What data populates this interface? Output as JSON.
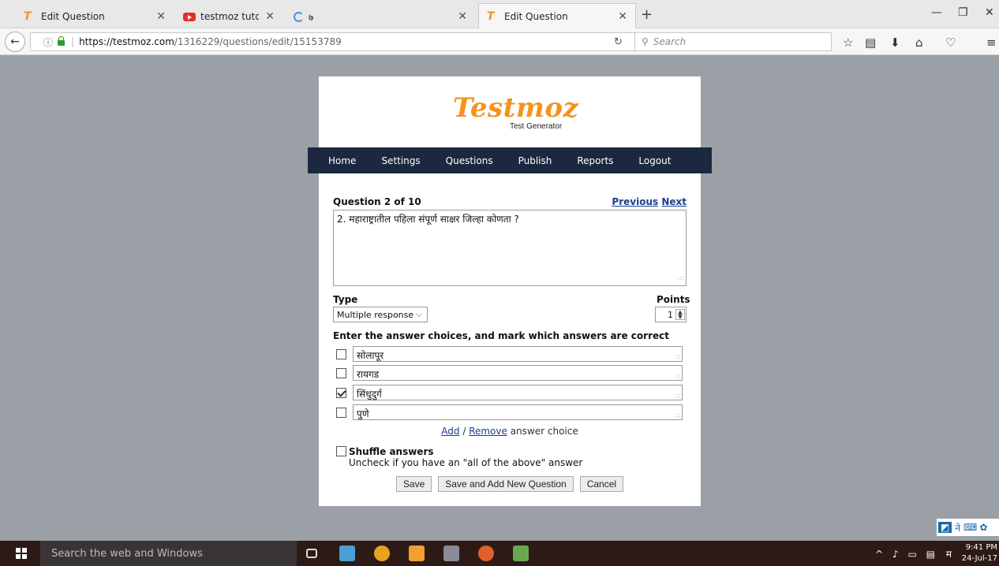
{
  "browser": {
    "tabs": [
      {
        "label": "Edit Question",
        "icon": "testmoz-icon"
      },
      {
        "label": "testmoz tutorial - YouTube",
        "icon": "youtube-icon"
      },
      {
        "label": "७",
        "icon": "loading-icon"
      },
      {
        "label": "Edit Question",
        "icon": "testmoz-icon"
      }
    ],
    "url_host": "https://testmoz.com",
    "url_path": "/1316229/questions/edit/15153789",
    "search_placeholder": "Search"
  },
  "app": {
    "logo": "Testmoz",
    "logo_subtitle": "Test Generator",
    "nav": [
      "Home",
      "Settings",
      "Questions",
      "Publish",
      "Reports",
      "Logout"
    ],
    "brand_color": "#f5931e",
    "nav_color": "#1b2840"
  },
  "question": {
    "header": "Question 2 of 10",
    "previous_label": "Previous",
    "next_label": "Next",
    "text": "2. महाराष्ट्रातील पहिला संपूर्ण साक्षर जिल्हा कोणता ?",
    "type_label": "Type",
    "type_value": "Multiple response",
    "points_label": "Points",
    "points_value": "1",
    "choices_label": "Enter the answer choices, and mark which answers are correct",
    "choices": [
      {
        "text": "सोलापूर",
        "correct": false
      },
      {
        "text": "रायगड",
        "correct": false
      },
      {
        "text": "सिंधुदुर्ग",
        "correct": true
      },
      {
        "text": "पुणे",
        "correct": false
      }
    ],
    "add_label": "Add",
    "remove_label": "Remove",
    "answer_choice_suffix": " answer choice",
    "shuffle_label": "Shuffle answers",
    "shuffle_hint": "Uncheck if you have an \"all of the above\" answer",
    "buttons": {
      "save": "Save",
      "save_new": "Save and Add New Question",
      "cancel": "Cancel"
    }
  },
  "taskbar": {
    "search_placeholder": "Search the web and Windows",
    "lang": "म",
    "time": "9:41 PM",
    "date": "24-Jul-17"
  }
}
